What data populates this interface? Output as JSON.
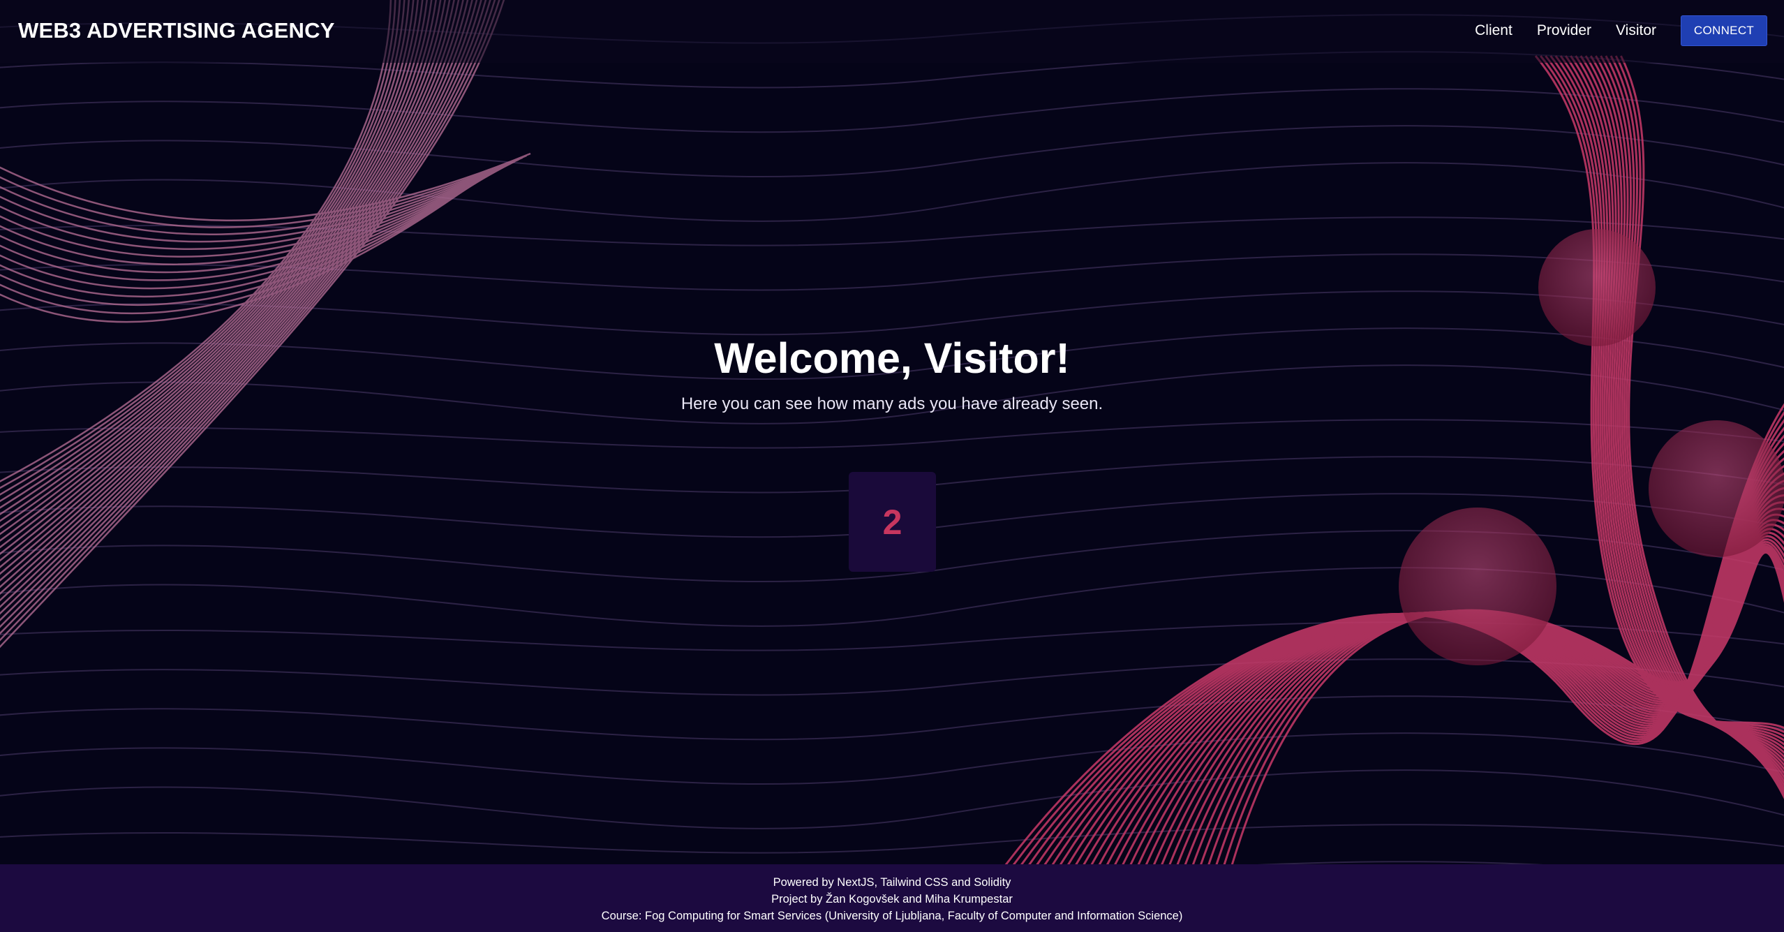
{
  "header": {
    "brand": "WEB3 ADVERTISING AGENCY",
    "nav": [
      {
        "label": "Client"
      },
      {
        "label": "Provider"
      },
      {
        "label": "Visitor"
      }
    ],
    "connect_label": "CONNECT"
  },
  "hero": {
    "title": "Welcome, Visitor!",
    "subtitle": "Here you can see how many ads you have already seen."
  },
  "counter": {
    "ads_seen": "2"
  },
  "footer": {
    "line1": "Powered by NextJS, Tailwind CSS and Solidity",
    "line2": "Project by Žan Kogovšek and Miha Krumpestar",
    "line3": "Course: Fog Computing for Smart Services (University of Ljubljana, Faculty of Computer and Information Science)"
  },
  "colors": {
    "background": "#050418",
    "accent_pink": "#c8365f",
    "connect_button": "#1f3fb3",
    "footer": "#1c0a40",
    "counter_box": "#1a0a3a"
  }
}
